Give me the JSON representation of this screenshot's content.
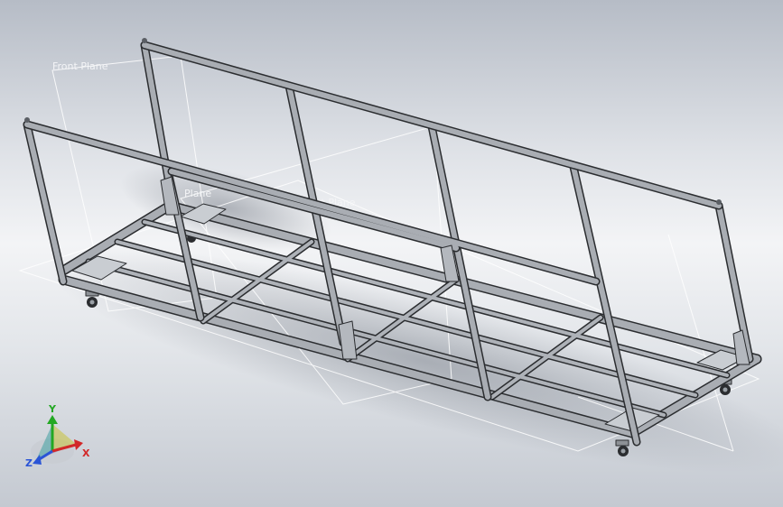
{
  "viewport": {
    "background_top": "#b6bcc6",
    "background_bottom": "#c4c9d1"
  },
  "planes": [
    {
      "label": "Front Plane"
    },
    {
      "label": "Front Plane"
    },
    {
      "label": "Plane"
    }
  ],
  "triad": {
    "x_label": "X",
    "y_label": "Y",
    "z_label": "Z",
    "x_color": "#d22828",
    "y_color": "#23a823",
    "z_color": "#2a54d6"
  },
  "model": {
    "frame_color": "#a9adb3",
    "edge_color": "#2b2d30"
  }
}
